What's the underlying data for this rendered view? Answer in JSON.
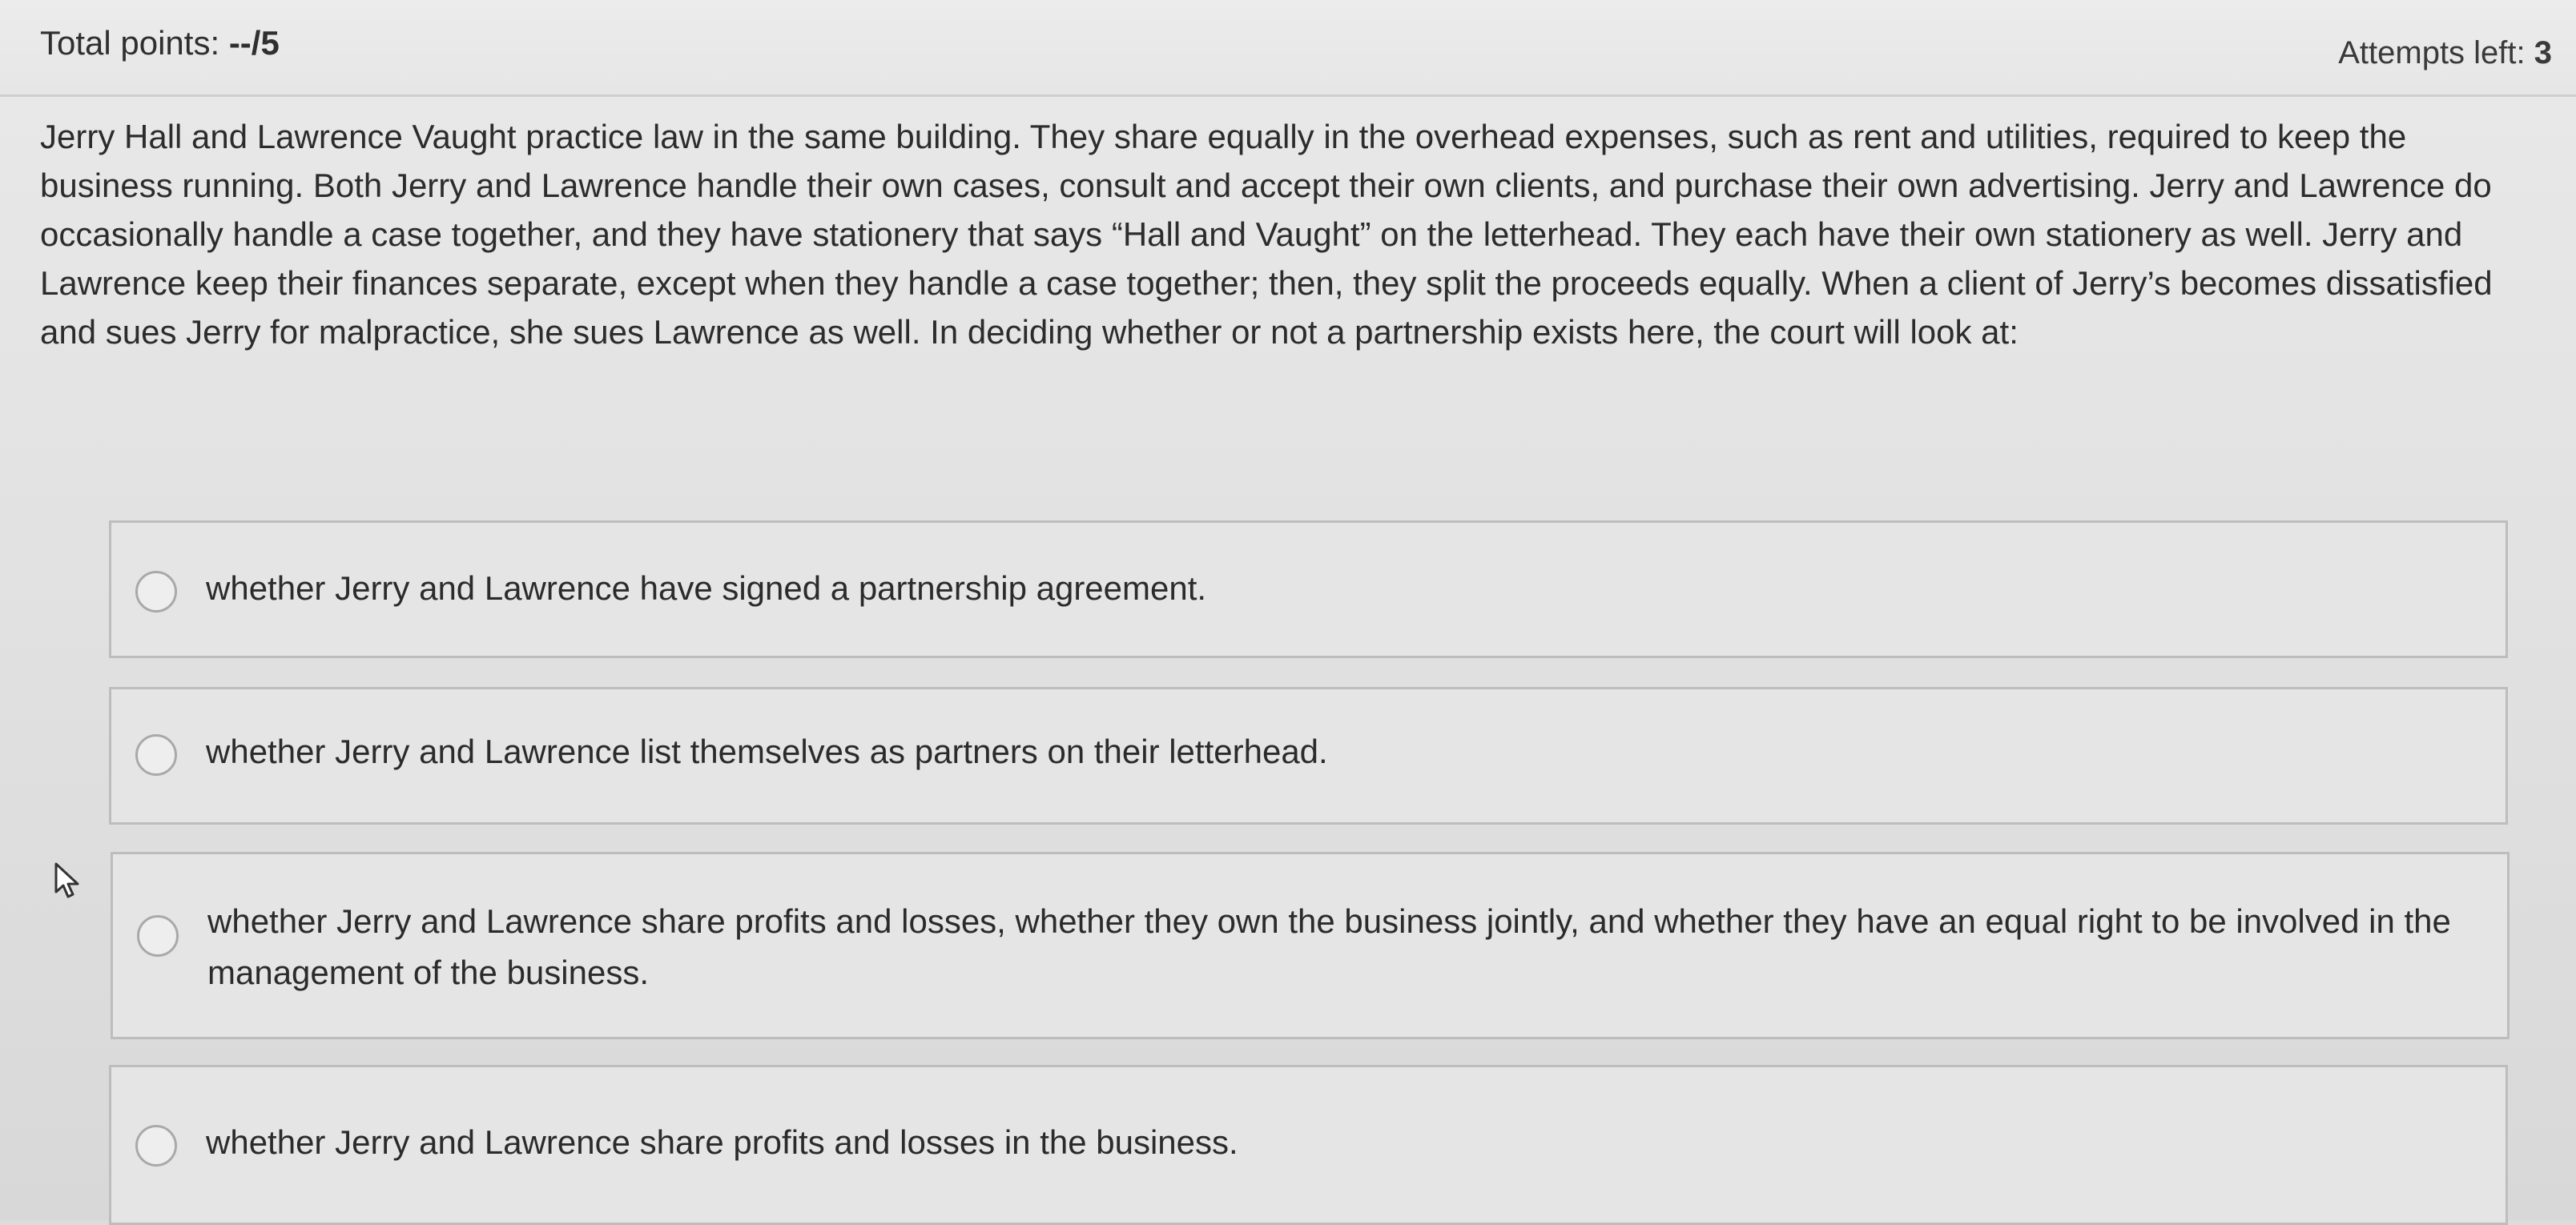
{
  "header": {
    "total_points_label": "Total points: ",
    "total_points_value": "--/5",
    "attempts_label": "Attempts left: ",
    "attempts_value": "3"
  },
  "question": {
    "text": "Jerry Hall and Lawrence Vaught practice law in the same building. They share equally in the overhead expenses, such as rent and utilities, required to keep the business running. Both Jerry and Lawrence handle their own cases, consult and accept their own clients, and purchase their own advertising. Jerry and Lawrence do occasionally handle a case together, and they have stationery that says “Hall and Vaught” on the letterhead. They each have their own stationery as well. Jerry and Lawrence keep their finances separate, except when they handle a case together; then, they split the proceeds equally. When a client of Jerry’s becomes dissatisfied and sues Jerry for malpractice, she sues Lawrence as well. In deciding whether or not a partnership exists here, the court will look at:"
  },
  "options": [
    {
      "label": "whether Jerry and Lawrence have signed a partnership agreement.",
      "selected": false
    },
    {
      "label": "whether Jerry and Lawrence list themselves as partners on their letterhead.",
      "selected": false
    },
    {
      "label": "whether Jerry and Lawrence share profits and losses, whether they own the business jointly, and whether they have an equal right to be involved in the management of the business.",
      "selected": false
    },
    {
      "label": "whether Jerry and Lawrence share profits and losses in the business.",
      "selected": false
    }
  ],
  "cursor": {
    "icon": "mouse-pointer-icon"
  }
}
